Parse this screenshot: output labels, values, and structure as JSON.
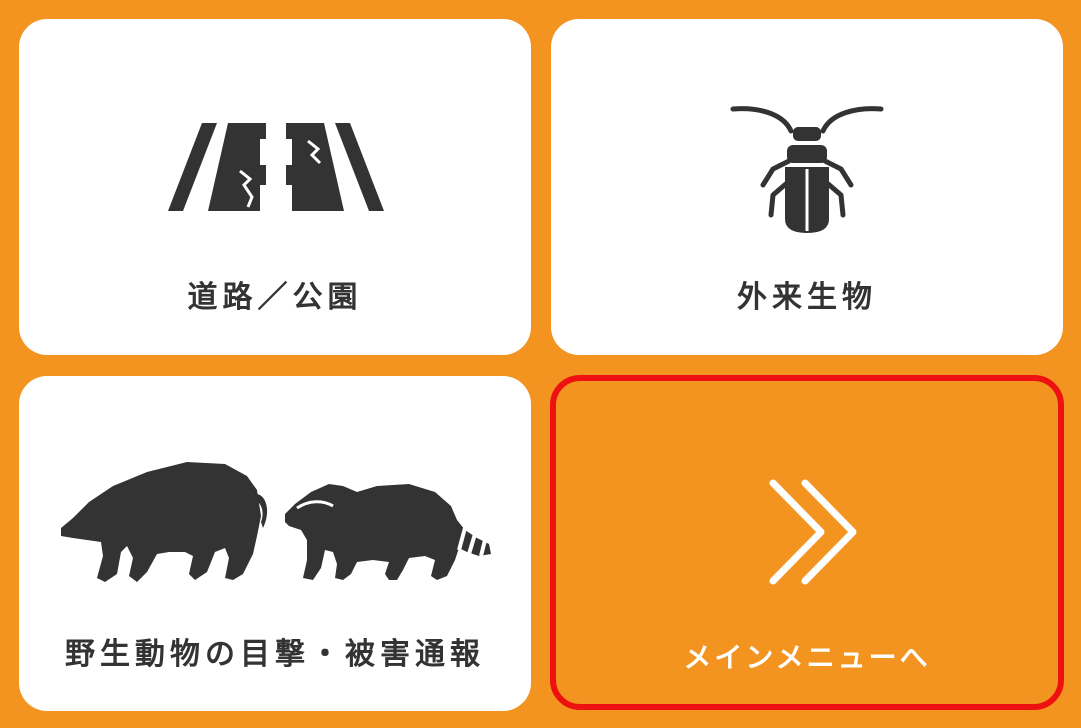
{
  "menu": {
    "items": [
      {
        "label": "道路／公園",
        "icon": "road-icon"
      },
      {
        "label": "外来生物",
        "icon": "beetle-icon"
      },
      {
        "label": "野生動物の目撃・被害通報",
        "icon": "wild-animals-icon"
      },
      {
        "label": "メインメニューへ",
        "icon": "double-chevron-right-icon"
      }
    ]
  },
  "colors": {
    "background": "#f39320",
    "tile": "#ffffff",
    "icon": "#333333",
    "highlight_border": "#ee1111",
    "back_text": "#ffffff"
  }
}
